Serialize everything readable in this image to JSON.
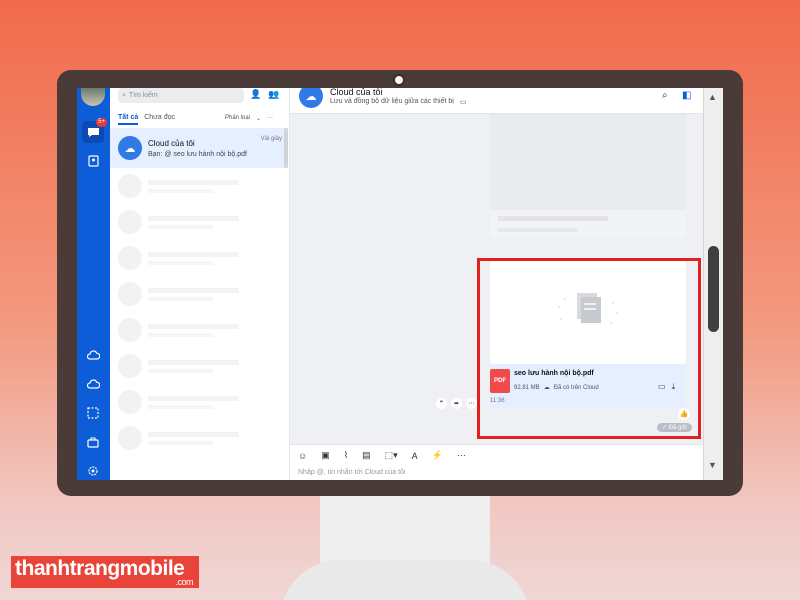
{
  "sidebar": {
    "badge": "5+"
  },
  "conversations": {
    "search_placeholder": "Tìm kiếm",
    "tab_all": "Tất cả",
    "tab_unread": "Chưa đọc",
    "filter_label": "Phân loại",
    "more": "···",
    "selected": {
      "name": "Cloud của tôi",
      "time": "Vài giây",
      "preview": "Bạn: @ seo lưu hành nội bộ.pdf"
    }
  },
  "chat": {
    "title": "Cloud của tôi",
    "subtitle": "Lưu và đồng bộ dữ liệu giữa các thiết bị",
    "file": {
      "name": "seo lưu hành nội bộ.pdf",
      "size": "92.81 MB",
      "cloud_status": "Đã có trên Cloud",
      "time": "11:36",
      "type_label": "PDF"
    },
    "sent_status": "Đã gửi",
    "composer_placeholder": "Nhập @, tin nhắn tới Cloud của tôi"
  },
  "watermark": {
    "brand": "thanhtrangmobile",
    "suffix": ".com"
  },
  "colors": {
    "accent": "#0d5cd8",
    "highlight": "#e12020",
    "pdf": "#f04b4b"
  }
}
